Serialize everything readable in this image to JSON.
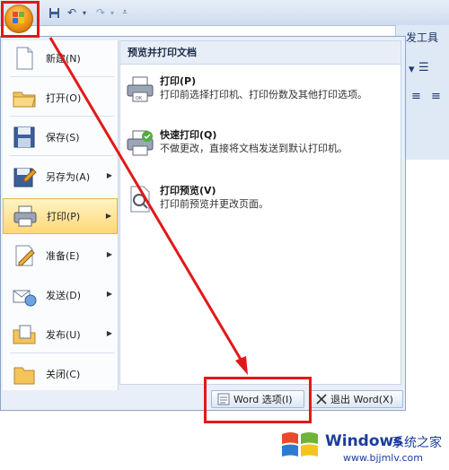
{
  "ribbon": {
    "dev_tab_partial": "发工具"
  },
  "menu_items": [
    {
      "label": "新建(N)"
    },
    {
      "label": "打开(O)"
    },
    {
      "label": "保存(S)"
    },
    {
      "label": "另存为(A)"
    },
    {
      "label": "打印(P)"
    },
    {
      "label": "准备(E)"
    },
    {
      "label": "发送(D)"
    },
    {
      "label": "发布(U)"
    },
    {
      "label": "关闭(C)"
    }
  ],
  "submenu": {
    "title": "预览并打印文档",
    "items": [
      {
        "title": "打印(P)",
        "desc": "打印前选择打印机、打印份数及其他打印选项。"
      },
      {
        "title": "快速打印(Q)",
        "desc": "不做更改，直接将文档发送到默认打印机。"
      },
      {
        "title": "打印预览(V)",
        "desc": "打印前预览并更改页面。"
      }
    ]
  },
  "bottom": {
    "options_label": "Word 选项(I)",
    "exit_label": "退出 Word(X)"
  },
  "watermark": {
    "brand": "Windows",
    "cn": "系统之家",
    "url": "www.bjjmlv.com"
  },
  "colors": {
    "annotation": "#e21818",
    "highlight": "#ffd876"
  }
}
